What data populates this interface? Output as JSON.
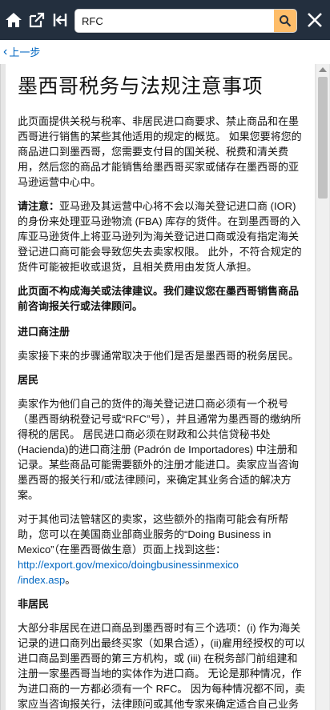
{
  "toolbar": {
    "home_icon": "home-icon",
    "open_icon": "open-external-icon",
    "collapse_icon": "collapse-icon",
    "search_value": "RFC",
    "search_icon": "search-icon",
    "close_icon": "close-icon"
  },
  "nav": {
    "back_label": "上一步"
  },
  "article": {
    "title": "墨西哥税务与法规注意事项",
    "intro": "此页面提供关税与税率、非居民进口商要求、禁止商品和在墨西哥进行销售的某些其他适用的规定的概览。 如果您要将您的商品进口到墨西哥，您需要支付目的国关税、税费和清关费用，然后您的商品才能销售给墨西哥买家或储存在墨西哥的亚马逊运营中心中。",
    "notice_label": "请注意：",
    "notice_text": "亚马逊及其运营中心将不会以海关登记进口商 (IOR) 的身份来处理亚马逊物流 (FBA) 库存的货件。在到墨西哥的入库亚马逊货件上将亚马逊列为海关登记进口商或没有指定海关登记进口商可能会导致您失去卖家权限。 此外，不符合规定的货件可能被拒收或退货，且相关费用由发货人承担。",
    "disclaimer": "此页面不构成海关或法律建议。我们建议您在墨西哥销售商品前咨询报关行或法律顾问。",
    "section_importer": "进口商注册",
    "importer_text": "卖家接下来的步骤通常取决于他们是否是墨西哥的税务居民。",
    "section_resident": "居民",
    "resident_text": "卖家作为他们自己的货件的海关登记进口商必须有一个税号（墨西哥纳税登记号或“RFC”号），并且通常为墨西哥的缴纳所得税的居民。 居民进口商必须在财政和公共信贷秘书处 (Hacienda)的进口商注册 (Padrón de Importadores) 中注册和记录。某些商品可能需要额外的注册才能进口。卖家应当咨询墨西哥的报关行和/或法律顾问，来确定其业务合适的解决方案。",
    "guide_text": "对于其他司法管辖区的卖家，这些额外的指南可能会有所帮助，您可以在美国商业部商业服务的“Doing Business in Mexico”（在墨西哥做生意）页面上找到这些：",
    "guide_link": "http://export.gov/mexico/doingbusinessinmexico/index.asp",
    "guide_link_line1": "http://export.gov/mexico/doingbusinessinmexico",
    "guide_link_line2": "/index.asp",
    "guide_end": "。",
    "section_nonresident": "非居民",
    "nonresident_text": "大部分非居民在进口商品到墨西哥时有三个选项：(i) 作为海关记录的进口商列出最终买家（如果合适），(ii)雇用经授权的可以进口商品到墨西哥的第三方机构，或 (iii) 在税务部门前组建和注册一家墨西哥当地的实体作为进口商。 无论是那种情况，作为进口商的一方都必须有一个 RFC。 因为每种情况都不同，卖家应当咨询报关行，法律顾问或其他专家来确定适合自己业务的合适方案。"
  },
  "colors": {
    "topbar": "#232f3e",
    "search_button": "#febd69",
    "link": "#0066c0"
  }
}
